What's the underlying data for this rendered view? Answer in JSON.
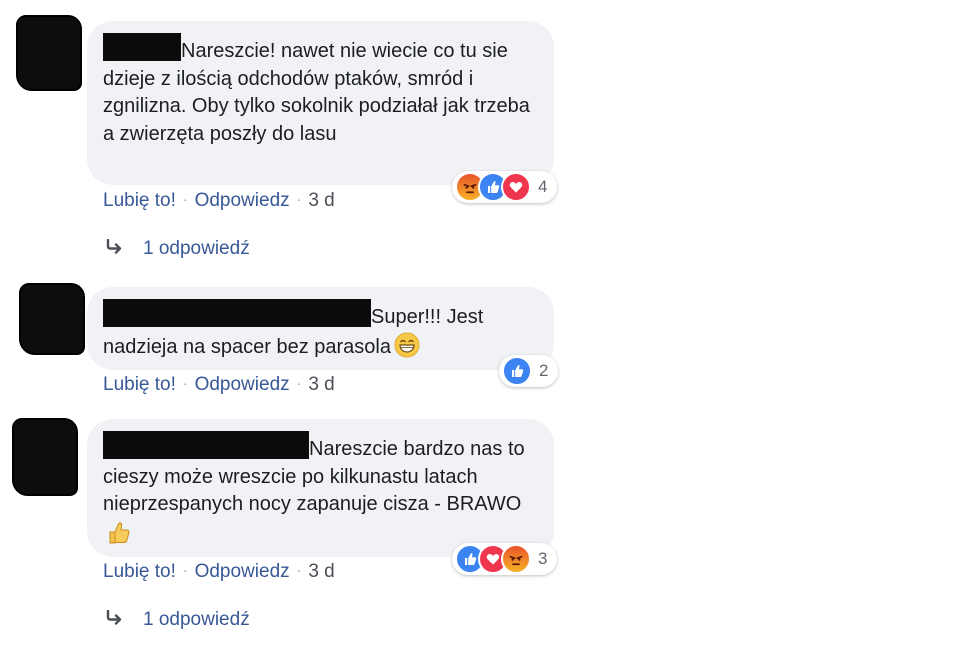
{
  "comments": [
    {
      "text": "Nareszcie! nawet nie wiecie co tu sie dzieje z ilością odchodów ptaków, smród i zgnilizna. Oby tylko sokolnik podziałał jak trzeba a zwierzęta poszły do lasu",
      "actions": {
        "like": "Lubię to!",
        "reply": "Odpowiedz",
        "time": "3 d"
      },
      "reactions": {
        "icons": [
          "angry-icon",
          "like-icon",
          "love-icon"
        ],
        "count": "4"
      },
      "replies": "1 odpowiedź"
    },
    {
      "text": "Super!!! Jest nadzieja na spacer bez parasola",
      "emoji": "grinning-face-icon",
      "actions": {
        "like": "Lubię to!",
        "reply": "Odpowiedz",
        "time": "3 d"
      },
      "reactions": {
        "icons": [
          "like-icon"
        ],
        "count": "2"
      }
    },
    {
      "text": "Nareszcie bardzo nas to cieszy może wreszcie po kilkunastu latach nieprzespanych nocy zapanuje cisza - BRAWO",
      "emoji": "thumbs-up-icon",
      "actions": {
        "like": "Lubię to!",
        "reply": "Odpowiedz",
        "time": "3 d"
      },
      "reactions": {
        "icons": [
          "like-icon",
          "love-icon",
          "angry-icon"
        ],
        "count": "3"
      },
      "replies": "1 odpowiedź"
    }
  ],
  "colors": {
    "bubble": "#f0f2f5",
    "link": "#385898",
    "like": "#3b84f2",
    "love": "#f0364f",
    "angry": "#e9542a"
  }
}
